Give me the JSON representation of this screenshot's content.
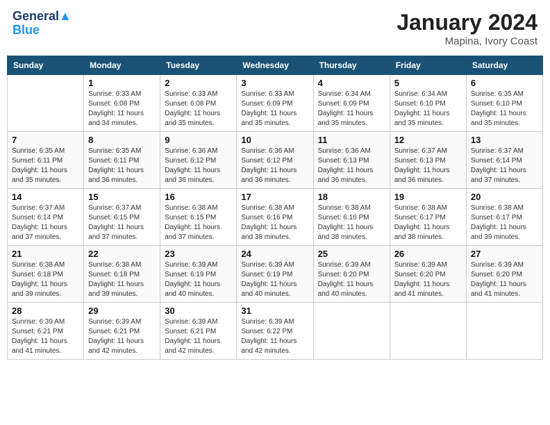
{
  "header": {
    "logo_line1": "General",
    "logo_line2": "Blue",
    "month_title": "January 2024",
    "location": "Mapina, Ivory Coast"
  },
  "days_of_week": [
    "Sunday",
    "Monday",
    "Tuesday",
    "Wednesday",
    "Thursday",
    "Friday",
    "Saturday"
  ],
  "weeks": [
    [
      {
        "day": "",
        "sunrise": "",
        "sunset": "",
        "daylight": ""
      },
      {
        "day": "1",
        "sunrise": "Sunrise: 6:33 AM",
        "sunset": "Sunset: 6:08 PM",
        "daylight": "Daylight: 11 hours and 34 minutes."
      },
      {
        "day": "2",
        "sunrise": "Sunrise: 6:33 AM",
        "sunset": "Sunset: 6:08 PM",
        "daylight": "Daylight: 11 hours and 35 minutes."
      },
      {
        "day": "3",
        "sunrise": "Sunrise: 6:33 AM",
        "sunset": "Sunset: 6:09 PM",
        "daylight": "Daylight: 11 hours and 35 minutes."
      },
      {
        "day": "4",
        "sunrise": "Sunrise: 6:34 AM",
        "sunset": "Sunset: 6:09 PM",
        "daylight": "Daylight: 11 hours and 35 minutes."
      },
      {
        "day": "5",
        "sunrise": "Sunrise: 6:34 AM",
        "sunset": "Sunset: 6:10 PM",
        "daylight": "Daylight: 11 hours and 35 minutes."
      },
      {
        "day": "6",
        "sunrise": "Sunrise: 6:35 AM",
        "sunset": "Sunset: 6:10 PM",
        "daylight": "Daylight: 11 hours and 35 minutes."
      }
    ],
    [
      {
        "day": "7",
        "sunrise": "Sunrise: 6:35 AM",
        "sunset": "Sunset: 6:11 PM",
        "daylight": "Daylight: 11 hours and 35 minutes."
      },
      {
        "day": "8",
        "sunrise": "Sunrise: 6:35 AM",
        "sunset": "Sunset: 6:11 PM",
        "daylight": "Daylight: 11 hours and 36 minutes."
      },
      {
        "day": "9",
        "sunrise": "Sunrise: 6:36 AM",
        "sunset": "Sunset: 6:12 PM",
        "daylight": "Daylight: 11 hours and 36 minutes."
      },
      {
        "day": "10",
        "sunrise": "Sunrise: 6:36 AM",
        "sunset": "Sunset: 6:12 PM",
        "daylight": "Daylight: 11 hours and 36 minutes."
      },
      {
        "day": "11",
        "sunrise": "Sunrise: 6:36 AM",
        "sunset": "Sunset: 6:13 PM",
        "daylight": "Daylight: 11 hours and 36 minutes."
      },
      {
        "day": "12",
        "sunrise": "Sunrise: 6:37 AM",
        "sunset": "Sunset: 6:13 PM",
        "daylight": "Daylight: 11 hours and 36 minutes."
      },
      {
        "day": "13",
        "sunrise": "Sunrise: 6:37 AM",
        "sunset": "Sunset: 6:14 PM",
        "daylight": "Daylight: 11 hours and 37 minutes."
      }
    ],
    [
      {
        "day": "14",
        "sunrise": "Sunrise: 6:37 AM",
        "sunset": "Sunset: 6:14 PM",
        "daylight": "Daylight: 11 hours and 37 minutes."
      },
      {
        "day": "15",
        "sunrise": "Sunrise: 6:37 AM",
        "sunset": "Sunset: 6:15 PM",
        "daylight": "Daylight: 11 hours and 37 minutes."
      },
      {
        "day": "16",
        "sunrise": "Sunrise: 6:38 AM",
        "sunset": "Sunset: 6:15 PM",
        "daylight": "Daylight: 11 hours and 37 minutes."
      },
      {
        "day": "17",
        "sunrise": "Sunrise: 6:38 AM",
        "sunset": "Sunset: 6:16 PM",
        "daylight": "Daylight: 11 hours and 38 minutes."
      },
      {
        "day": "18",
        "sunrise": "Sunrise: 6:38 AM",
        "sunset": "Sunset: 6:16 PM",
        "daylight": "Daylight: 11 hours and 38 minutes."
      },
      {
        "day": "19",
        "sunrise": "Sunrise: 6:38 AM",
        "sunset": "Sunset: 6:17 PM",
        "daylight": "Daylight: 11 hours and 38 minutes."
      },
      {
        "day": "20",
        "sunrise": "Sunrise: 6:38 AM",
        "sunset": "Sunset: 6:17 PM",
        "daylight": "Daylight: 11 hours and 39 minutes."
      }
    ],
    [
      {
        "day": "21",
        "sunrise": "Sunrise: 6:38 AM",
        "sunset": "Sunset: 6:18 PM",
        "daylight": "Daylight: 11 hours and 39 minutes."
      },
      {
        "day": "22",
        "sunrise": "Sunrise: 6:38 AM",
        "sunset": "Sunset: 6:18 PM",
        "daylight": "Daylight: 11 hours and 39 minutes."
      },
      {
        "day": "23",
        "sunrise": "Sunrise: 6:39 AM",
        "sunset": "Sunset: 6:19 PM",
        "daylight": "Daylight: 11 hours and 40 minutes."
      },
      {
        "day": "24",
        "sunrise": "Sunrise: 6:39 AM",
        "sunset": "Sunset: 6:19 PM",
        "daylight": "Daylight: 11 hours and 40 minutes."
      },
      {
        "day": "25",
        "sunrise": "Sunrise: 6:39 AM",
        "sunset": "Sunset: 6:20 PM",
        "daylight": "Daylight: 11 hours and 40 minutes."
      },
      {
        "day": "26",
        "sunrise": "Sunrise: 6:39 AM",
        "sunset": "Sunset: 6:20 PM",
        "daylight": "Daylight: 11 hours and 41 minutes."
      },
      {
        "day": "27",
        "sunrise": "Sunrise: 6:39 AM",
        "sunset": "Sunset: 6:20 PM",
        "daylight": "Daylight: 11 hours and 41 minutes."
      }
    ],
    [
      {
        "day": "28",
        "sunrise": "Sunrise: 6:39 AM",
        "sunset": "Sunset: 6:21 PM",
        "daylight": "Daylight: 11 hours and 41 minutes."
      },
      {
        "day": "29",
        "sunrise": "Sunrise: 6:39 AM",
        "sunset": "Sunset: 6:21 PM",
        "daylight": "Daylight: 11 hours and 42 minutes."
      },
      {
        "day": "30",
        "sunrise": "Sunrise: 6:39 AM",
        "sunset": "Sunset: 6:21 PM",
        "daylight": "Daylight: 11 hours and 42 minutes."
      },
      {
        "day": "31",
        "sunrise": "Sunrise: 6:39 AM",
        "sunset": "Sunset: 6:22 PM",
        "daylight": "Daylight: 11 hours and 42 minutes."
      },
      {
        "day": "",
        "sunrise": "",
        "sunset": "",
        "daylight": ""
      },
      {
        "day": "",
        "sunrise": "",
        "sunset": "",
        "daylight": ""
      },
      {
        "day": "",
        "sunrise": "",
        "sunset": "",
        "daylight": ""
      }
    ]
  ]
}
